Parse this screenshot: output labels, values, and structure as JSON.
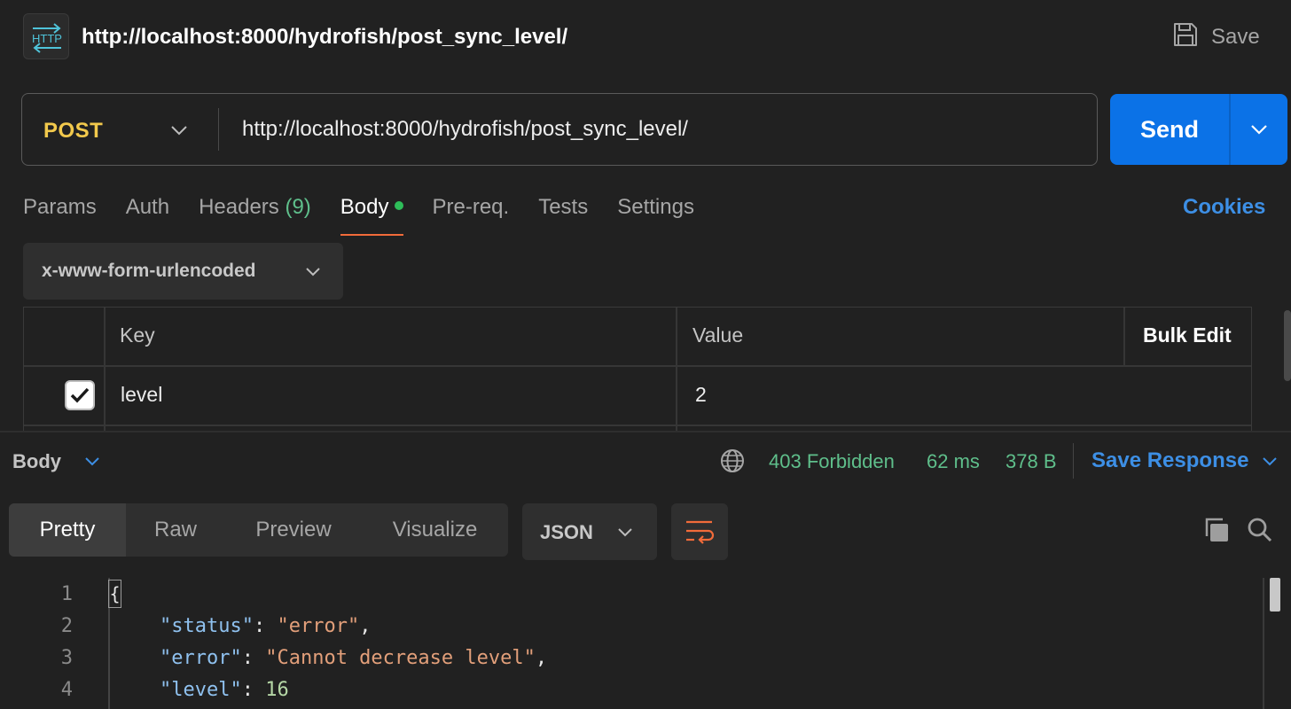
{
  "header": {
    "title": "http://localhost:8000/hydrofish/post_sync_level/",
    "icon_text": "HTTP",
    "save_label": "Save"
  },
  "request": {
    "method": "POST",
    "url": "http://localhost:8000/hydrofish/post_sync_level/",
    "send_label": "Send"
  },
  "tabs": {
    "params": "Params",
    "auth": "Auth",
    "headers": "Headers",
    "headers_count": "(9)",
    "body": "Body",
    "prereq": "Pre-req.",
    "tests": "Tests",
    "settings": "Settings",
    "cookies": "Cookies"
  },
  "body_type": "x-www-form-urlencoded",
  "params_table": {
    "key_header": "Key",
    "value_header": "Value",
    "bulk_edit": "Bulk Edit",
    "rows": [
      {
        "key": "level",
        "value": "2",
        "checked": true
      }
    ]
  },
  "response": {
    "section_label": "Body",
    "status": "403 Forbidden",
    "time": "62 ms",
    "size": "378 B",
    "save_response": "Save Response",
    "view_tabs": [
      "Pretty",
      "Raw",
      "Preview",
      "Visualize"
    ],
    "active_view": "Pretty",
    "format": "JSON",
    "line_numbers": [
      "1",
      "2",
      "3",
      "4"
    ],
    "json": {
      "open_brace": "{",
      "status_key": "\"status\"",
      "status_val": "\"error\"",
      "error_key": "\"error\"",
      "error_val": "\"Cannot decrease level\"",
      "level_key": "\"level\"",
      "level_val": "16"
    }
  },
  "colors": {
    "accent_blue": "#0b72e7",
    "method_yellow": "#f2c94c",
    "status_green": "#5fbf8b",
    "tab_underline": "#f26b3a"
  }
}
